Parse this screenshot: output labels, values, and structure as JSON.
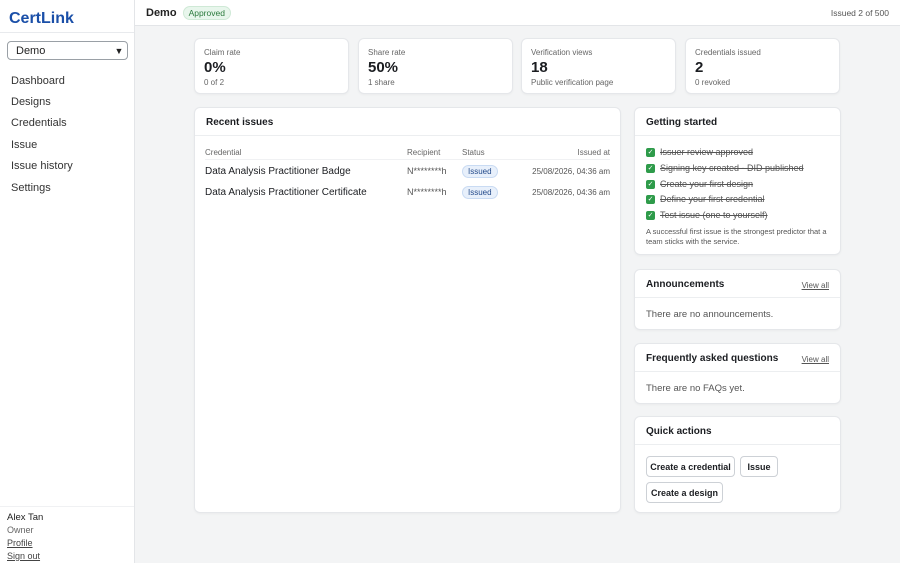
{
  "app": {
    "name": "CertLink"
  },
  "sidebar": {
    "workspace_select": "Demo",
    "nav": [
      {
        "label": "Dashboard"
      },
      {
        "label": "Designs"
      },
      {
        "label": "Credentials"
      },
      {
        "label": "Issue"
      },
      {
        "label": "Issue history"
      },
      {
        "label": "Settings"
      }
    ],
    "user": {
      "name": "Alex Tan",
      "role": "Owner",
      "profile": "Profile",
      "signout": "Sign out"
    }
  },
  "topbar": {
    "workspace": "Demo",
    "status": "Approved",
    "issued_count": "Issued 2 of 500"
  },
  "stats": [
    {
      "label": "Claim rate",
      "value": "0%",
      "sub": "0 of 2"
    },
    {
      "label": "Share rate",
      "value": "50%",
      "sub": "1 share"
    },
    {
      "label": "Verification views",
      "value": "18",
      "sub": "Public verification page"
    },
    {
      "label": "Credentials issued",
      "value": "2",
      "sub": "0 revoked"
    }
  ],
  "recent": {
    "title": "Recent issues",
    "headers": {
      "credential": "Credential",
      "recipient": "Recipient",
      "status": "Status",
      "issued_at": "Issued at"
    },
    "rows": [
      {
        "credential": "Data Analysis Practitioner Badge",
        "recipient": "N********h",
        "status": "Issued",
        "issued_at": "25/08/2026, 04:36 am"
      },
      {
        "credential": "Data Analysis Practitioner Certificate",
        "recipient": "N********h",
        "status": "Issued",
        "issued_at": "25/08/2026, 04:36 am"
      }
    ]
  },
  "getting_started": {
    "title": "Getting started",
    "steps": [
      {
        "label": "Issuer review approved"
      },
      {
        "label": "Signing key created - DID published"
      },
      {
        "label": "Create your first design"
      },
      {
        "label": "Define your first credential"
      },
      {
        "label": "Test issue (one to yourself)"
      }
    ],
    "hint": "A successful first issue is the strongest predictor that a team sticks with the service."
  },
  "announcements": {
    "title": "Announcements",
    "view_all": "View all",
    "empty": "There are no announcements."
  },
  "faq": {
    "title": "Frequently asked questions",
    "view_all": "View all",
    "empty": "There are no FAQs yet."
  },
  "quick_actions": {
    "title": "Quick actions",
    "create_credential": "Create a credential",
    "issue": "Issue",
    "create_design": "Create a design"
  },
  "colors": {
    "brand": "#1a4fa8",
    "approved": "#2a7a3c",
    "check": "#2e9b4a"
  }
}
